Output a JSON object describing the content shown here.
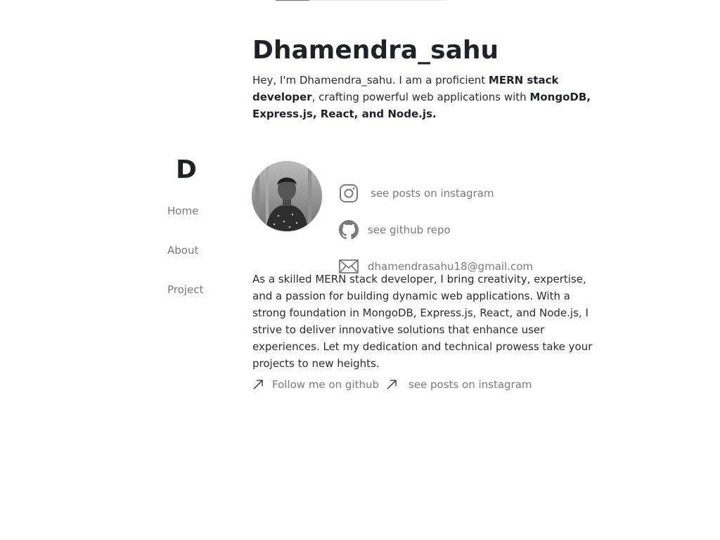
{
  "progress": {
    "fraction": 0.2
  },
  "sidebar": {
    "logo": "D",
    "items": [
      {
        "label": "Home"
      },
      {
        "label": "About"
      },
      {
        "label": "Project"
      }
    ]
  },
  "header": {
    "title": "Dhamendra_sahu",
    "intro": {
      "p1": "Hey, I'm Dhamendra_sahu. I am a proficient ",
      "b1": "MERN stack developer",
      "p2": ", crafting powerful web applications with ",
      "b2": "MongoDB, Express.js, React, and Node.js."
    }
  },
  "profile": {
    "contacts": [
      {
        "icon": "instagram-icon",
        "label": "see posts on instagram"
      },
      {
        "icon": "github-icon",
        "label": "see github repo"
      },
      {
        "icon": "mail-icon",
        "label": "dhamendrasahu18@gmail.com"
      }
    ]
  },
  "bio": "As a skilled MERN stack developer, I bring creativity, expertise, and a passion for building dynamic web applications. With a strong foundation in MongoDB, Express.js, React, and Node.js, I strive to deliver innovative solutions that enhance user experiences. Let my dedication and technical prowess take your projects to new heights.",
  "footer_links": [
    {
      "icon": "arrow-up-right-icon",
      "label": "Follow me on github"
    },
    {
      "icon": "arrow-up-right-icon",
      "label": "see posts on instagram"
    }
  ],
  "colors": {
    "text": "#1f2328",
    "muted": "#7a7a7a",
    "background": "#ffffff"
  }
}
